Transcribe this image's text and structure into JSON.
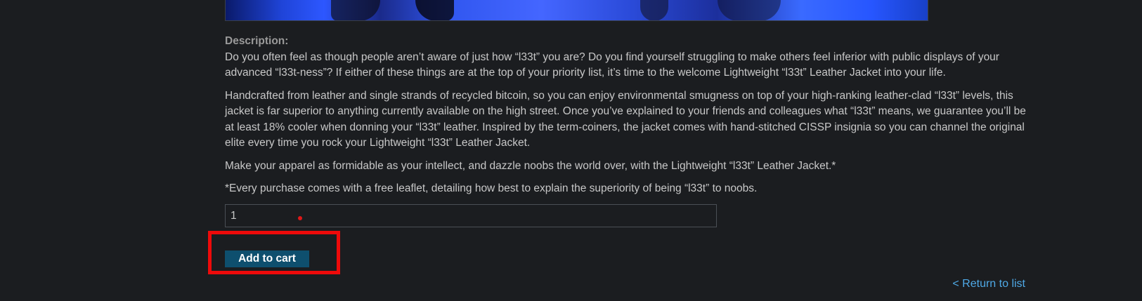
{
  "product": {
    "image_alt": "Lightweight \"l33t\" Leather Jacket"
  },
  "description": {
    "heading": "Description:",
    "paragraphs": [
      "Do you often feel as though people aren’t aware of just how “l33t” you are? Do you find yourself struggling to make others feel inferior with public displays of your advanced “l33t-ness”? If either of these things are at the top of your priority list, it’s time to the welcome Lightweight “l33t” Leather Jacket into your life.",
      "Handcrafted from leather and single strands of recycled bitcoin, so you can enjoy environmental smugness on top of your high-ranking leather-clad “l33t” levels, this jacket is far superior to anything currently available on the high street. Once you’ve explained to your friends and colleagues what “l33t” means, we guarantee you’ll be at least 18% cooler when donning your “l33t” leather. Inspired by the term-coiners, the jacket comes with hand-stitched CISSP insignia so you can channel the original elite every time you rock your Lightweight “l33t” Leather Jacket.",
      "Make your apparel as formidable as your intellect, and dazzle noobs the world over, with the Lightweight “l33t” Leather Jacket.*",
      "*Every purchase comes with a free leaflet, detailing how best to explain the superiority of being “l33t” to noobs."
    ]
  },
  "cart": {
    "quantity_value": "1",
    "add_button_label": "Add to cart"
  },
  "nav": {
    "return_link_label": "< Return to list"
  },
  "colors": {
    "background": "#1b1d20",
    "button": "#0e4f6e",
    "link": "#4fa9e6",
    "highlight": "#ee0a0a"
  }
}
